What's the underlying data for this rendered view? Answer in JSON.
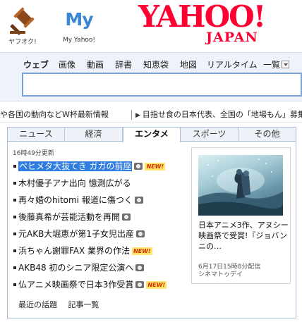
{
  "services": {
    "auction_label": "ヤフオク!",
    "my_logo": "My",
    "my_label": "My Yahoo!"
  },
  "logo": {
    "main": "YAHOO!",
    "sub": "JAPAN"
  },
  "search": {
    "tabs": [
      {
        "label": "ウェブ",
        "active": true
      },
      {
        "label": "画像"
      },
      {
        "label": "動画"
      },
      {
        "label": "辞書"
      },
      {
        "label": "知恵袋"
      },
      {
        "label": "地図"
      },
      {
        "label": "リアルタイム"
      },
      {
        "label": "一覧"
      }
    ],
    "query": ""
  },
  "ticker": {
    "item1": "や各国の動向などW杯最新情報",
    "item2": "目指せ食の日本代表、全国の「地場もん」募集"
  },
  "news": {
    "tabs": [
      {
        "label": "ニュース"
      },
      {
        "label": "経済"
      },
      {
        "label": "エンタメ",
        "active": true
      },
      {
        "label": "スポーツ"
      },
      {
        "label": "その他"
      }
    ],
    "updated": "16時49分更新",
    "headlines": [
      {
        "text": "ペヒメタ大抜てき ガガの前座",
        "camera": true,
        "new_badge": "NEW!",
        "selected": true
      },
      {
        "text": "木村優子アナ出向 憶測広がる",
        "camera": false
      },
      {
        "text": "再々婚のhitomi 報道に傷つく",
        "camera": true
      },
      {
        "text": "後藤真希が芸能活動を再開",
        "camera": true
      },
      {
        "text": "元AKB大堀恵が第1子女児出産",
        "camera": true
      },
      {
        "text": "浜ちゃん謝罪FAX 業界の作法",
        "camera": false,
        "new_badge": "NEW!"
      },
      {
        "text": "AKB48 初のシニア限定公演へ",
        "camera": true
      },
      {
        "text": "仏アニメ映画祭で日本3作受賞",
        "camera": true,
        "new_badge": "NEW!"
      }
    ],
    "footer": {
      "recent": "最近の話題",
      "list": "記事一覧"
    }
  },
  "feature": {
    "title": "日本アニメ3作、アヌシー映画祭で受賞!『ジョバンニの…",
    "date": "6月17日15時8分配信",
    "source": "シネマトゥデイ"
  },
  "colors": {
    "brand_red": "#ff0033",
    "link_blue": "#2f7de1",
    "search_border": "#7aa0d8"
  }
}
